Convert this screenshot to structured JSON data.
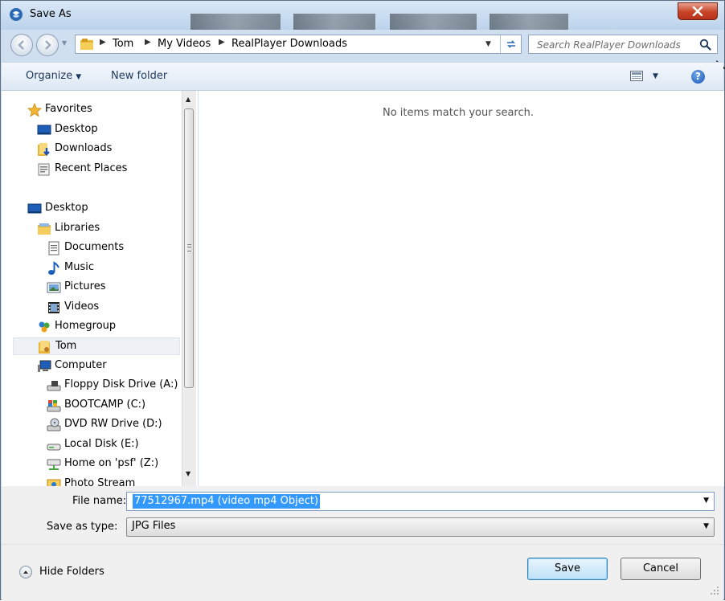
{
  "window": {
    "title": "Save As"
  },
  "address": {
    "crumbs": [
      "Tom",
      "My Videos",
      "RealPlayer Downloads"
    ],
    "search_placeholder": "Search RealPlayer Downloads"
  },
  "toolbar": {
    "organize": "Organize",
    "new_folder": "New folder",
    "help": "?"
  },
  "nav": {
    "items": [
      {
        "label": "Favorites",
        "icon": "star-icon"
      },
      {
        "label": "Desktop",
        "icon": "desktop-icon"
      },
      {
        "label": "Downloads",
        "icon": "downloads-icon"
      },
      {
        "label": "Recent Places",
        "icon": "recent-places-icon"
      },
      {
        "label": "Desktop",
        "icon": "desktop-icon"
      },
      {
        "label": "Libraries",
        "icon": "libraries-icon"
      },
      {
        "label": "Documents",
        "icon": "documents-icon"
      },
      {
        "label": "Music",
        "icon": "music-icon"
      },
      {
        "label": "Pictures",
        "icon": "pictures-icon"
      },
      {
        "label": "Videos",
        "icon": "videos-icon"
      },
      {
        "label": "Homegroup",
        "icon": "homegroup-icon"
      },
      {
        "label": "Tom",
        "icon": "user-folder-icon",
        "selected": true
      },
      {
        "label": "Computer",
        "icon": "computer-icon"
      },
      {
        "label": "Floppy Disk Drive (A:)",
        "icon": "floppy-drive-icon"
      },
      {
        "label": "BOOTCAMP (C:)",
        "icon": "windows-drive-icon"
      },
      {
        "label": "DVD RW Drive (D:)",
        "icon": "dvd-drive-icon"
      },
      {
        "label": "Local Disk (E:)",
        "icon": "hard-disk-icon"
      },
      {
        "label": "Home on 'psf' (Z:)",
        "icon": "network-drive-icon"
      },
      {
        "label": "Photo Stream",
        "icon": "photo-stream-icon"
      }
    ]
  },
  "content": {
    "empty_message": "No items match your search."
  },
  "fields": {
    "file_name_label": "File name:",
    "file_name_value": "77512967.mp4 (video mp4 Object)",
    "save_type_label": "Save as type:",
    "save_type_value": "JPG Files"
  },
  "buttons": {
    "hide_folders": "Hide Folders",
    "save": "Save",
    "cancel": "Cancel"
  },
  "colors": {
    "selection": "#3399ff",
    "title_gradient_top": "#d9e7f6",
    "close_red": "#c64326"
  }
}
